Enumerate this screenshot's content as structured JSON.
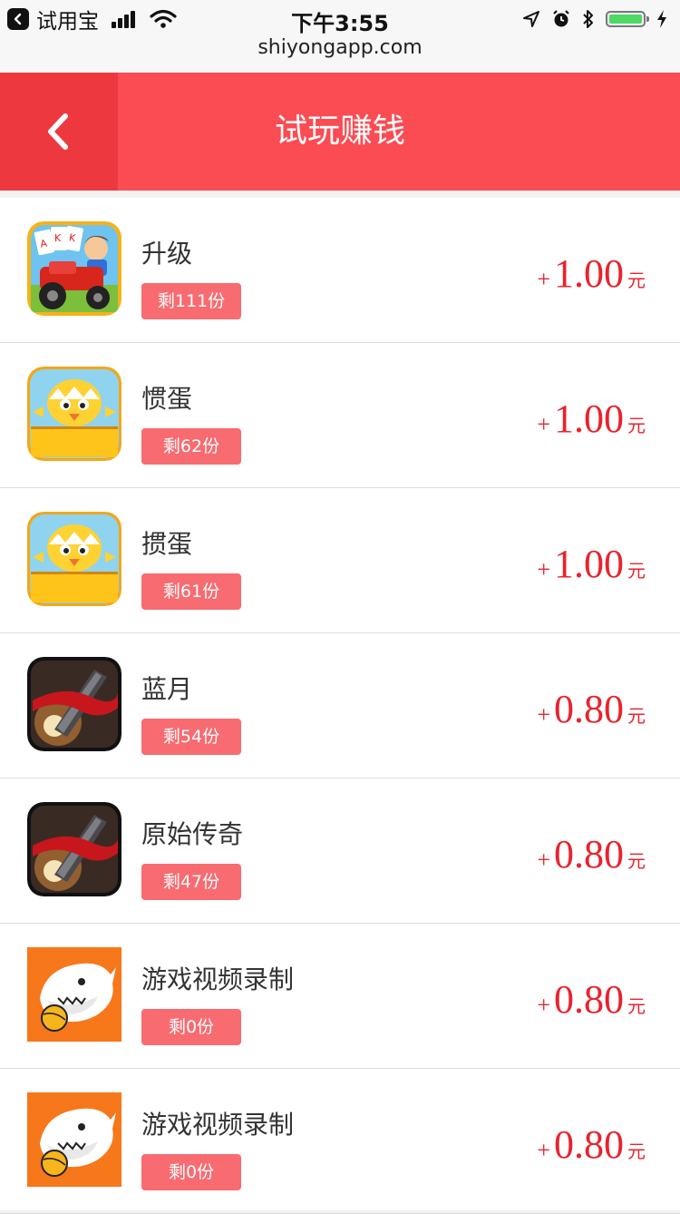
{
  "status_bar": {
    "back_app_label": "试用宝",
    "time": "下午3:55",
    "url": "shiyongapp.com",
    "icons": [
      "signal-icon",
      "wifi-icon",
      "location-icon",
      "alarm-icon",
      "bluetooth-icon",
      "battery-icon",
      "charging-icon"
    ]
  },
  "header": {
    "title": "试玩赚钱",
    "back_icon": "chevron-left-icon",
    "color": "#fb4b53"
  },
  "accent_color": "#e8232d",
  "items": [
    {
      "name": "升级",
      "remaining": "剩111份",
      "plus": "+",
      "amount": "1.00",
      "unit": "元",
      "icon": "card-game-tractor-icon"
    },
    {
      "name": "惯蛋",
      "remaining": "剩62份",
      "plus": "+",
      "amount": "1.00",
      "unit": "元",
      "icon": "guandan-chick-icon"
    },
    {
      "name": "掼蛋",
      "remaining": "剩61份",
      "plus": "+",
      "amount": "1.00",
      "unit": "元",
      "icon": "guandan-chick-icon"
    },
    {
      "name": "蓝月",
      "remaining": "剩54份",
      "plus": "+",
      "amount": "0.80",
      "unit": "元",
      "icon": "sword-red-ribbon-icon"
    },
    {
      "name": "原始传奇",
      "remaining": "剩47份",
      "plus": "+",
      "amount": "0.80",
      "unit": "元",
      "icon": "sword-red-ribbon-icon"
    },
    {
      "name": "游戏视频录制",
      "remaining": "剩0份",
      "plus": "+",
      "amount": "0.80",
      "unit": "元",
      "icon": "shark-mascot-icon"
    },
    {
      "name": "游戏视频录制",
      "remaining": "剩0份",
      "plus": "+",
      "amount": "0.80",
      "unit": "元",
      "icon": "shark-mascot-icon"
    }
  ]
}
